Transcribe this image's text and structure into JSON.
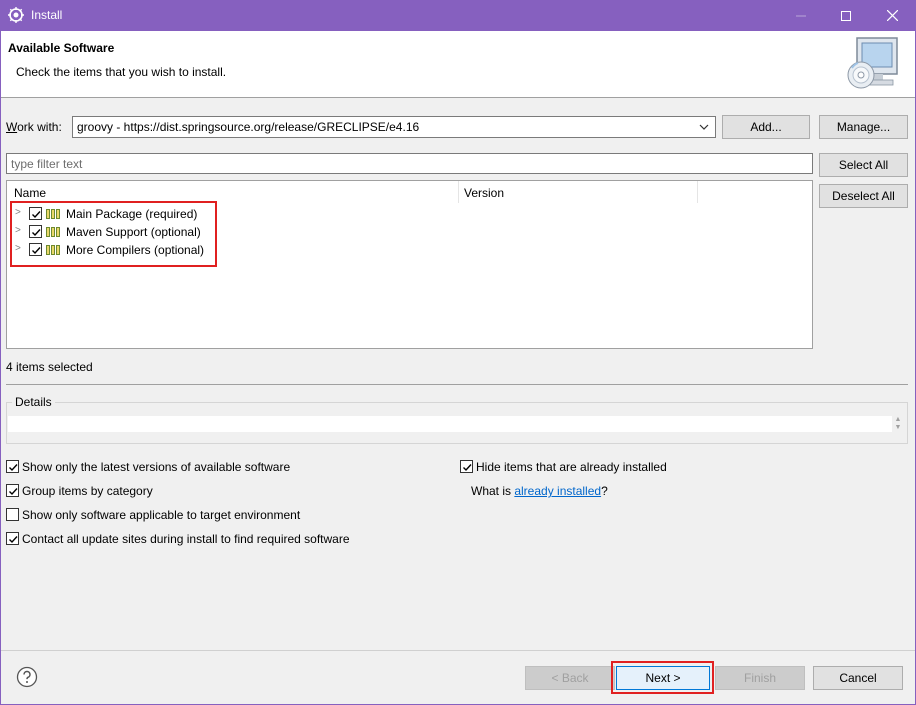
{
  "window": {
    "title": "Install"
  },
  "header": {
    "title": "Available Software",
    "description": "Check the items that you wish to install."
  },
  "work_with": {
    "label": "Work with:",
    "value": "groovy - https://dist.springsource.org/release/GRECLIPSE/e4.16",
    "add_label": "Add...",
    "manage_label": "Manage..."
  },
  "filter": {
    "placeholder": "type filter text"
  },
  "side_buttons": {
    "select_all": "Select All",
    "deselect_all": "Deselect All"
  },
  "table": {
    "columns": [
      "Name",
      "Version"
    ],
    "rows": [
      {
        "name": "Main Package (required)",
        "version": "",
        "checked": true
      },
      {
        "name": "Maven Support (optional)",
        "version": "",
        "checked": true
      },
      {
        "name": "More Compilers (optional)",
        "version": "",
        "checked": true
      }
    ]
  },
  "status": {
    "selected_text": "4 items selected"
  },
  "details": {
    "label": "Details"
  },
  "options": {
    "latest_versions": {
      "label": "Show only the latest versions of available software",
      "checked": true
    },
    "group_by_category": {
      "label": "Group items by category",
      "checked": true
    },
    "applicable_only": {
      "label": "Show only software applicable to target environment",
      "checked": false
    },
    "contact_sites": {
      "label": "Contact all update sites during install to find required software",
      "checked": true
    },
    "hide_installed": {
      "label": "Hide items that are already installed",
      "checked": true
    },
    "what_is_prefix": "What is ",
    "already_installed_link": "already installed",
    "what_is_suffix": "?"
  },
  "buttons": {
    "back": "< Back",
    "next": "Next >",
    "finish": "Finish",
    "cancel": "Cancel"
  },
  "colors": {
    "titlebar": "#8660bf",
    "highlight_box": "#e02020",
    "link": "#0066cc"
  }
}
